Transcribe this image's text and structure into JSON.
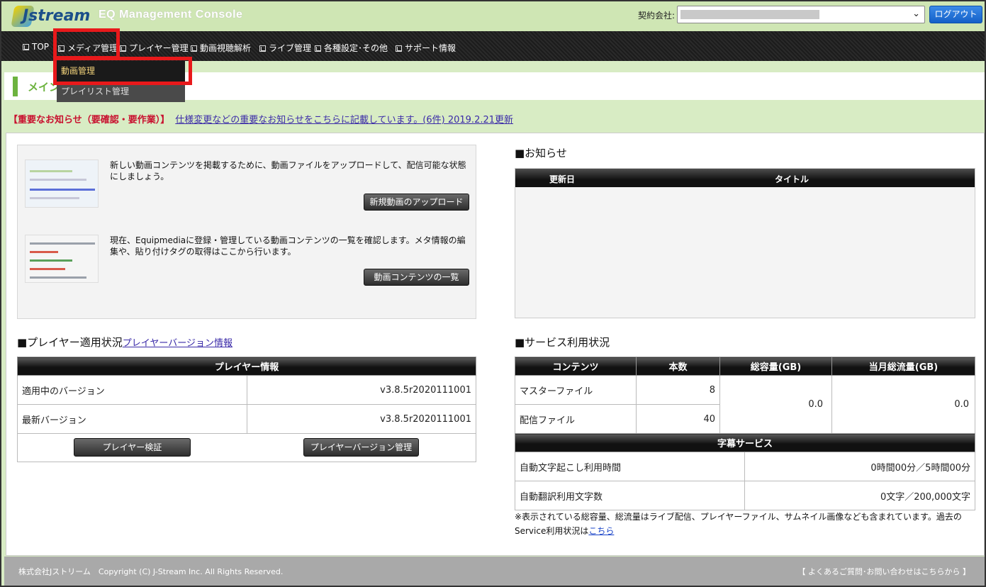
{
  "header": {
    "logo_text": "Jstream",
    "console_title": "EQ Management Console",
    "contract_label": "契約会社:",
    "logout_label": "ログアウト"
  },
  "nav": {
    "items": [
      "TOP",
      "メディア管理",
      "プレイヤー管理",
      "動画視聴解析",
      "ライブ管理",
      "各種設定･その他",
      "サポート情報"
    ]
  },
  "dropdown": {
    "items": [
      "動画管理",
      "プレイリスト管理"
    ]
  },
  "page_title": "メイン",
  "notice": {
    "label": "【重要なお知らせ（要確認・要作業）】",
    "link": "仕様変更などの重要なお知らせをこちらに記載しています。(6件) 2019.2.21更新"
  },
  "upload": {
    "text": "新しい動画コンテンツを掲載するために、動画ファイルをアップロードして、配信可能な状態にしましょう。",
    "button": "新規動画のアップロード"
  },
  "contents": {
    "text": "現在、Equipmediaに登録・管理している動画コンテンツの一覧を確認します。メタ情報の編集や、貼り付けタグの取得はここから行います。",
    "button": "動画コンテンツの一覧"
  },
  "news": {
    "heading": "■お知らせ",
    "col_date": "更新日",
    "col_title": "タイトル"
  },
  "player": {
    "heading": "■プレイヤー適用状況",
    "heading_link": "プレイヤーバージョン情報",
    "table_header": "プレイヤー情報",
    "rows": [
      {
        "label": "適用中のバージョン",
        "value": "v3.8.5r2020111001"
      },
      {
        "label": "最新バージョン",
        "value": "v3.8.5r2020111001"
      }
    ],
    "verify_button": "プレイヤー検証",
    "version_button": "プレイヤーバージョン管理"
  },
  "service": {
    "heading": "■サービス利用状況",
    "headers": [
      "コンテンツ",
      "本数",
      "総容量(GB)",
      "当月総流量(GB)"
    ],
    "rows": [
      {
        "label": "マスターファイル",
        "count": "8"
      },
      {
        "label": "配信ファイル",
        "count": "40"
      }
    ],
    "total_capacity": "0.0",
    "monthly_traffic": "0.0",
    "subtitle_header": "字幕サービス",
    "subtitle_rows": [
      {
        "label": "自動文字起こし利用時間",
        "value": "0時間00分／5時間00分"
      },
      {
        "label": "自動翻訳利用文字数",
        "value": "0文字／200,000文字"
      }
    ],
    "note": "※表示されている総容量、総流量はライブ配信、プレイヤーファイル、サムネイル画像なども含まれています。過去のService利用状況は",
    "note_link": "こちら"
  },
  "footer": {
    "copyright": "株式会社Jストリーム　Copyright (C) J-Stream Inc. All Rights Reserved.",
    "faq": "【 よくあるご質問･お問い合わせはこちらから 】"
  },
  "colors": {
    "header_bg": "#cfe6b4",
    "highlight": "#e8191b",
    "logout": "#1560c8",
    "notice_red": "#c8102e"
  }
}
